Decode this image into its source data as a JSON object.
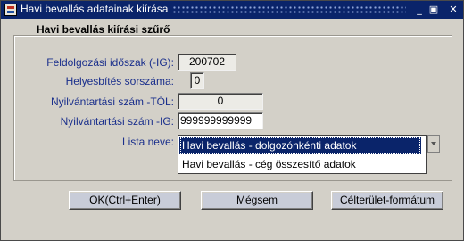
{
  "window": {
    "title": "Havi bevallás adatainak kiírása",
    "minimize_glyph": "_",
    "close_glyph": "✕",
    "maximize_glyph": "▣"
  },
  "group": {
    "title": "Havi bevallás kiírási szűrő"
  },
  "form": {
    "period_label": "Feldolgozási időszak (-IG):",
    "period_value": "200702",
    "correction_label": "Helyesbítés sorszáma:",
    "correction_value": "0",
    "reg_from_label": "Nyilvántartási szám -TÓL:",
    "reg_from_value": "0",
    "reg_to_label": "Nyilvántartási szám -IG:",
    "reg_to_value": "999999999999",
    "list_label": "Lista neve:",
    "list_options": [
      "Havi bevallás - dolgozónkénti adatok",
      "Havi bevallás - cég összesítő adatok"
    ],
    "list_selected": "Havi bevallás - dolgozónkénti adatok"
  },
  "buttons": {
    "ok": "OK(Ctrl+Enter)",
    "cancel": "Mégsem",
    "target_format": "Célterület-formátum"
  },
  "colors": {
    "titlebar": "#0a246a",
    "label_text": "#1a2f8c",
    "window_bg": "#d3d0c8",
    "selection": "#0a246a"
  }
}
